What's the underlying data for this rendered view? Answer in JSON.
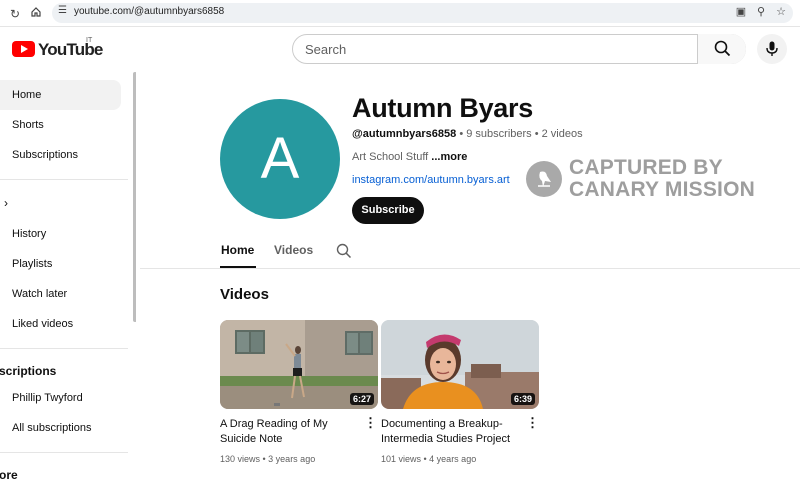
{
  "browser": {
    "url": "youtube.com/@autumnbyars6858"
  },
  "masthead": {
    "logo_text": "YouTube",
    "country_code": "IT",
    "search_placeholder": "Search"
  },
  "sidebar": {
    "items": [
      {
        "label": "Home",
        "active": true
      },
      {
        "label": "Shorts"
      },
      {
        "label": "Subscriptions"
      },
      {
        "label": "History"
      },
      {
        "label": "Playlists"
      },
      {
        "label": "Watch later"
      },
      {
        "label": "Liked videos"
      }
    ],
    "subscriptions_heading": "scriptions",
    "subscriptions": [
      {
        "label": "Phillip Twyford"
      },
      {
        "label": "All subscriptions"
      }
    ],
    "more_heading": "ore"
  },
  "channel": {
    "avatar_letter": "A",
    "name": "Autumn Byars",
    "handle": "@autumnbyars6858",
    "stats": " • 9 subscribers • 2 videos",
    "description": "Art School Stuff ",
    "more_label": "...more",
    "link": "instagram.com/autumn.byars.art",
    "subscribe_label": "Subscribe"
  },
  "watermark": {
    "line1": "CAPTURED BY",
    "line2": "CANARY MISSION"
  },
  "tabs": [
    {
      "label": "Home",
      "active": true
    },
    {
      "label": "Videos"
    }
  ],
  "section_title": "Videos",
  "videos": [
    {
      "title": "A Drag Reading of My Suicide Note",
      "meta": "130 views • 3 years ago",
      "duration": "6:27"
    },
    {
      "title": "Documenting a Breakup-Intermedia Studies Project",
      "meta": "101 views • 4 years ago",
      "duration": "6:39"
    }
  ],
  "colors": {
    "brand_red": "#ff0000",
    "avatar_teal": "#26999f",
    "link_blue": "#065fd4"
  }
}
